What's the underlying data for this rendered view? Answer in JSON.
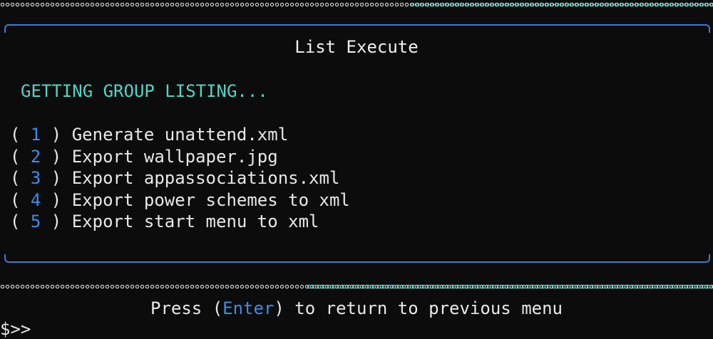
{
  "window": {
    "title": "List Execute"
  },
  "status_text": "GETTING GROUP LISTING...",
  "menu": {
    "items": [
      {
        "number": "1",
        "label": "Generate unattend.xml"
      },
      {
        "number": "2",
        "label": "Export wallpaper.jpg"
      },
      {
        "number": "3",
        "label": "Export appassociations.xml"
      },
      {
        "number": "4",
        "label": "Export power schemes to xml"
      },
      {
        "number": "5",
        "label": "Export start menu to xml"
      }
    ]
  },
  "footer": {
    "prefix": "Press (",
    "key": "Enter",
    "suffix": ") to return to previous menu"
  },
  "prompt": "$>>",
  "colors": {
    "accent_blue": "#3b8eea",
    "status_teal": "#4fd6c8",
    "frame_blue": "#3a7bd5",
    "background": "#0c0c0c"
  }
}
